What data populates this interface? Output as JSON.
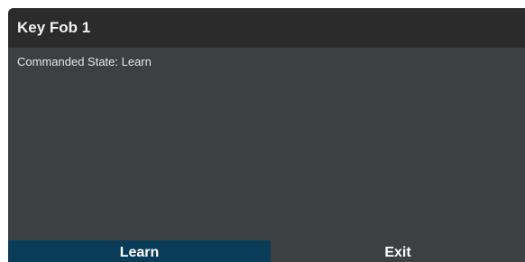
{
  "dialog": {
    "title": "Key Fob 1",
    "status_text": "Commanded State: Learn"
  },
  "buttons": {
    "learn_label": "Learn",
    "exit_label": "Exit"
  },
  "colors": {
    "title_bar": "#2b2b2b",
    "body": "#3c4043",
    "learn_button": "#0a3c5a",
    "text": "#ffffff"
  }
}
